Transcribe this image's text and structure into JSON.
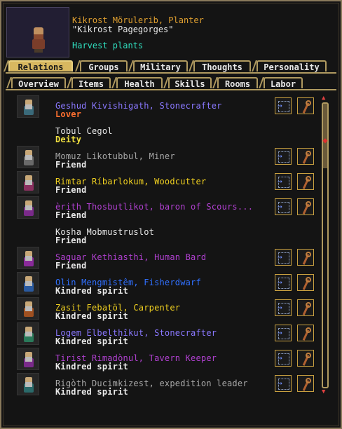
{
  "header": {
    "name": "Kikrost Mörulerib, Planter",
    "nickname": "\"Kikrost Pagegorges\"",
    "task": "Harvest plants"
  },
  "tabs_top": [
    {
      "label": "Relations",
      "active": true
    },
    {
      "label": "Groups",
      "active": false
    },
    {
      "label": "Military",
      "active": false
    },
    {
      "label": "Thoughts",
      "active": false
    },
    {
      "label": "Personality",
      "active": false
    }
  ],
  "tabs_bottom": [
    {
      "label": "Overview"
    },
    {
      "label": "Items"
    },
    {
      "label": "Health"
    },
    {
      "label": "Skills"
    },
    {
      "label": "Rooms"
    },
    {
      "label": "Labor"
    }
  ],
  "relations": [
    {
      "name": "Geshud Kivishigath, Stonecrafter",
      "relation": "Lover",
      "name_color": "#8a78ff",
      "rel_color": "#ff7030",
      "has_icon": true,
      "has_buttons": true,
      "body_color": "#3a6a7a"
    },
    {
      "name": "Tobul Cegol",
      "relation": "Deity",
      "name_color": "#e8e8e8",
      "rel_color": "#f0e040",
      "has_icon": false,
      "has_buttons": false,
      "body_color": ""
    },
    {
      "name": "Momuz Likotubbul, Miner",
      "relation": "Friend",
      "name_color": "#a8a8a8",
      "rel_color": "#e8e8e8",
      "has_icon": true,
      "has_buttons": true,
      "body_color": "#6a6a6a"
    },
    {
      "name": "Rimtar Ríbarlokum, Woodcutter",
      "relation": "Friend",
      "name_color": "#f0d020",
      "rel_color": "#e8e8e8",
      "has_icon": true,
      "has_buttons": true,
      "body_color": "#8a3060"
    },
    {
      "name": "èrith Thosbutlikot, baron of Scours...",
      "relation": "Friend",
      "name_color": "#b040d0",
      "rel_color": "#e8e8e8",
      "has_icon": true,
      "has_buttons": true,
      "body_color": "#7a2a8a"
    },
    {
      "name": "Kosha Mobmustruslot",
      "relation": "Friend",
      "name_color": "#e8e8e8",
      "rel_color": "#e8e8e8",
      "has_icon": false,
      "has_buttons": false,
      "body_color": ""
    },
    {
      "name": "Saquar Kethiasthi, Human Bard",
      "relation": "Friend",
      "name_color": "#b040d0",
      "rel_color": "#e8e8e8",
      "has_icon": true,
      "has_buttons": true,
      "body_color": "#8a2a9a"
    },
    {
      "name": "Olin Mengmistêm, Fisherdwarf",
      "relation": "Kindred spirit",
      "name_color": "#3070ff",
      "rel_color": "#e8e8e8",
      "has_icon": true,
      "has_buttons": true,
      "body_color": "#2a5aa0"
    },
    {
      "name": "Zasit Febatöl, Carpenter",
      "relation": "Kindred spirit",
      "name_color": "#f0d020",
      "rel_color": "#e8e8e8",
      "has_icon": true,
      "has_buttons": true,
      "body_color": "#a05020"
    },
    {
      "name": "Logem Elbelthîkut, Stonecrafter",
      "relation": "Kindred spirit",
      "name_color": "#8a78ff",
      "rel_color": "#e8e8e8",
      "has_icon": true,
      "has_buttons": true,
      "body_color": "#2a7a5a"
    },
    {
      "name": "Tirist Rimadònul, Tavern Keeper",
      "relation": "Kindred spirit",
      "name_color": "#b040d0",
      "rel_color": "#e8e8e8",
      "has_icon": true,
      "has_buttons": true,
      "body_color": "#7a2a8a"
    },
    {
      "name": "Rigòth Ducimkizest, expedition leader",
      "relation": "Kindred spirit",
      "name_color": "#a8a8a8",
      "rel_color": "#e8e8e8",
      "has_icon": true,
      "has_buttons": true,
      "body_color": "#2a6a6a"
    }
  ],
  "icons": {
    "view_button": "arrow-into-box-icon",
    "tool_button": "pick-tool-icon",
    "scroll_up": "scroll-up-arrow-icon",
    "scroll_down": "scroll-down-arrow-icon",
    "scroll_thumb": "scroll-thumb-icon"
  },
  "scrollbar": {
    "position_fraction": 0.12
  }
}
